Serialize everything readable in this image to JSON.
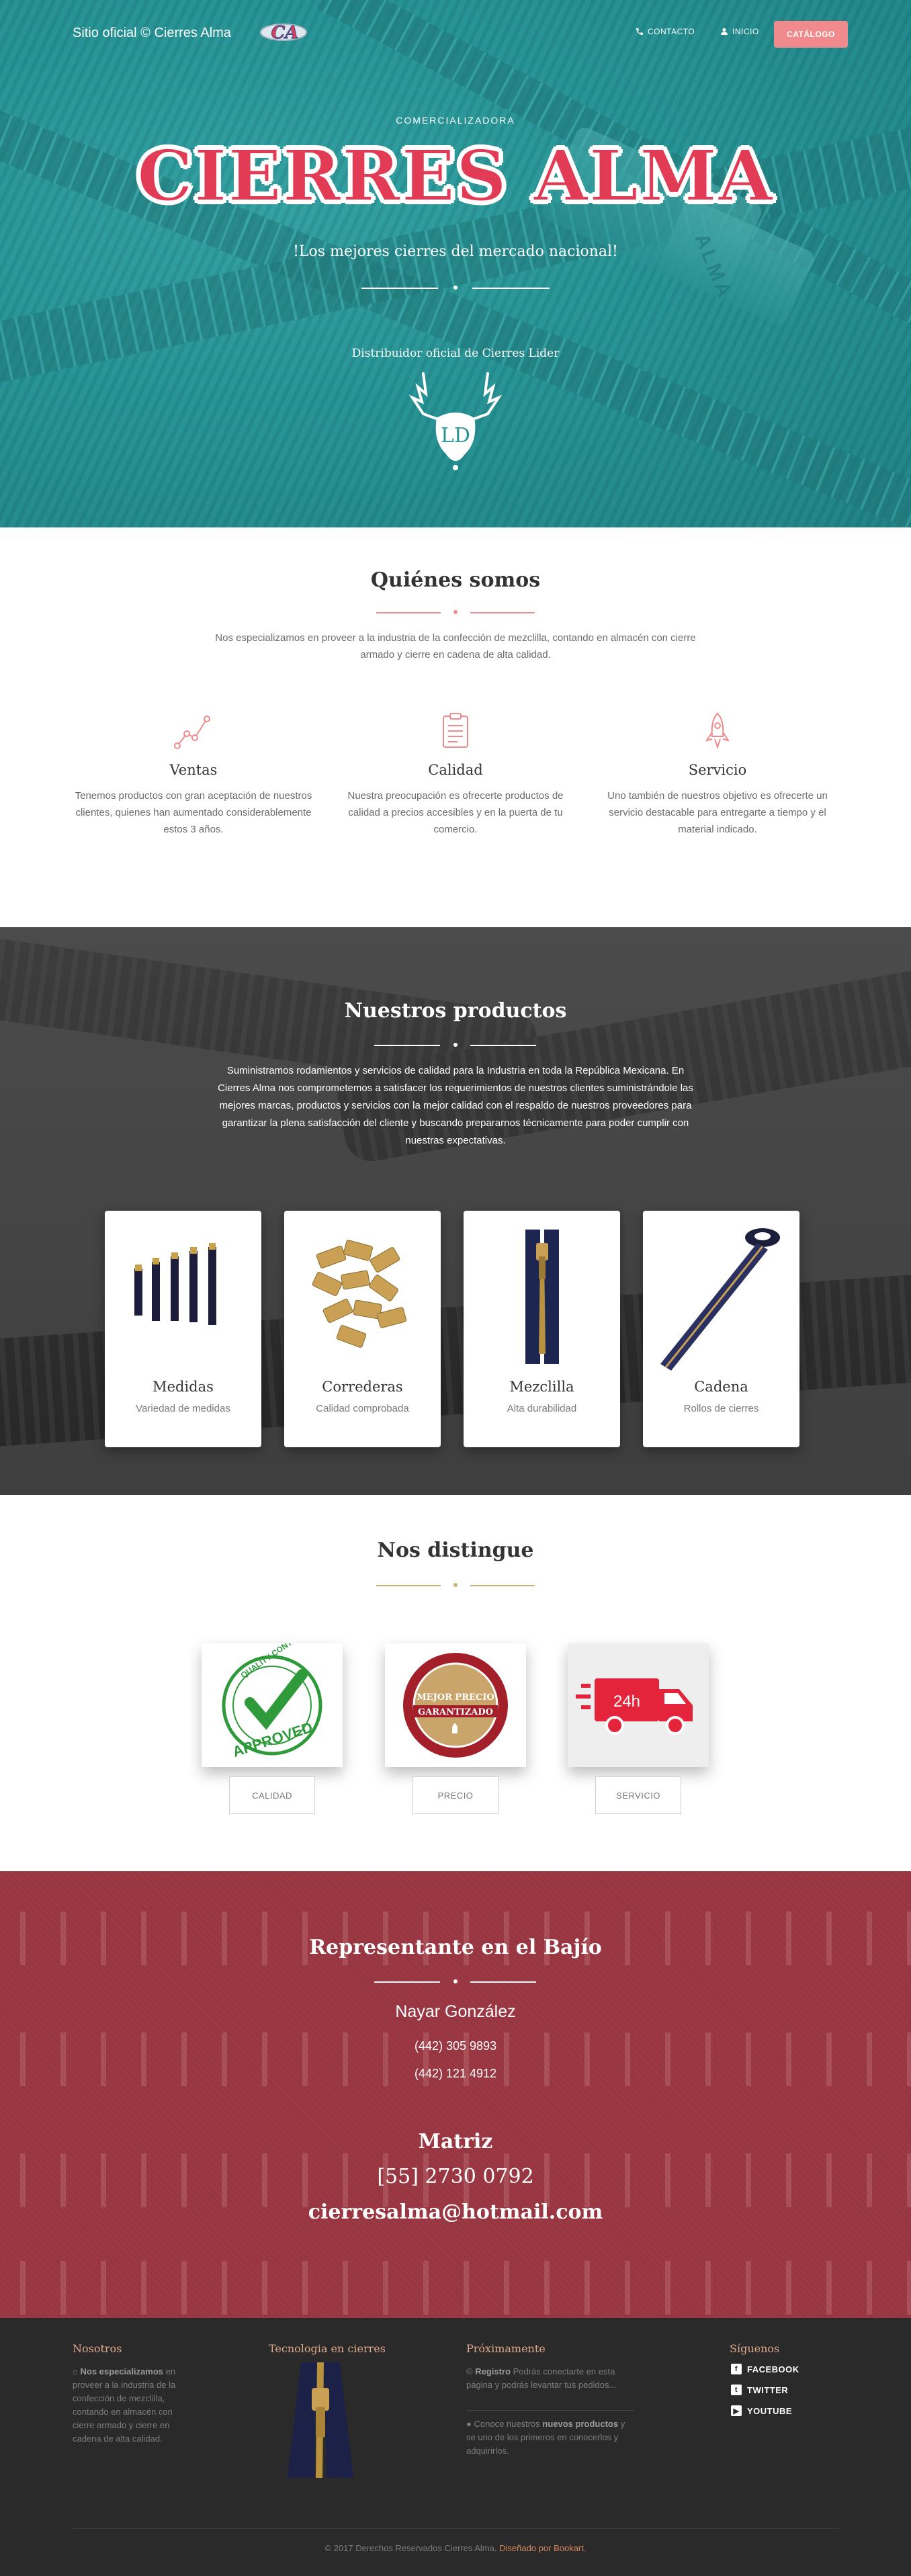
{
  "header": {
    "brand": "Sitio oficial © Cierres Alma",
    "logo_text": "CA",
    "nav": [
      {
        "label": "CONTACTO",
        "icon": "phone-icon"
      },
      {
        "label": "INICIO",
        "icon": "user-icon"
      }
    ],
    "cta": "CATÁLOGO"
  },
  "hero": {
    "eyebrow": "COMERCIALIZADORA",
    "title": "CIERRES ALMA",
    "subtitle": "!Los mejores cierres del mercado nacional!",
    "distributor": "Distribuidor oficial de Cierres Lider",
    "distributor_logo": "LD",
    "background_text": "ALMA"
  },
  "about": {
    "title": "Quiénes somos",
    "intro": "Nos especializamos en proveer a la industria de la confección de mezclilla, contando en almacén con cierre armado y cierre en cadena de alta calidad.",
    "features": [
      {
        "icon": "chart-line-icon",
        "title": "Ventas",
        "text": "Tenemos productos con gran aceptación de nuestros clientes, quienes han aumentado considerablemente estos 3 años."
      },
      {
        "icon": "clipboard-icon",
        "title": "Calidad",
        "text": "Nuestra preocupación es ofrecerte productos de calidad a precios accesibles y en la puerta de tu comercio."
      },
      {
        "icon": "rocket-icon",
        "title": "Servicio",
        "text": "Uno también de nuestros objetivo es ofrecerte un servicio destacable para entregarte a tiempo y el material indicado."
      }
    ]
  },
  "products": {
    "title": "Nuestros productos",
    "intro": "Suministramos rodamientos y servicios de calidad para la Industria en toda la República Mexicana. En Cierres Alma nos comprometemos a satisfacer los requerimientos de nuestros clientes suministrándole las mejores marcas, productos y servicios con la mejor calidad con el respaldo de nuestros proveedores para garantizar la plena satisfacción del cliente y buscando prepararnos técnicamente para poder cumplir con nuestras expectativas.",
    "cards": [
      {
        "title": "Medidas",
        "subtitle": "Variedad de medidas"
      },
      {
        "title": "Correderas",
        "subtitle": "Calidad comprobada"
      },
      {
        "title": "Mezclilla",
        "subtitle": "Alta durabilidad"
      },
      {
        "title": "Cadena",
        "subtitle": "Rollos de cierres"
      }
    ]
  },
  "distinguish": {
    "title": "Nos distingue",
    "badge_texts": {
      "quality_top": "QUALITY CONTROL",
      "quality_main": "APPROVED",
      "price_top": "MEJOR PRECIO",
      "price_main": "GARANTIZADO",
      "truck": "24h"
    },
    "buttons": [
      "CALIDAD",
      "PRECIO",
      "SERVICIO"
    ]
  },
  "representative": {
    "title": "Representante en el Bajío",
    "name": "Nayar González",
    "phone1": "(442) 305 9893",
    "phone2": "(442) 121 4912",
    "matrix_title": "Matriz",
    "matrix_phone": "[55] 2730 0792",
    "email": "cierresalma@hotmail.com"
  },
  "footer": {
    "col1": {
      "title": "Nosotros",
      "lead": "Nos especializamos",
      "text": "en proveer a la industria de la confección de mezclilla, contando en almacén con cierre armado y cierre en cadena de alta calidad."
    },
    "col2": {
      "title": "Tecnologia en cierres"
    },
    "col3": {
      "title": "Próximamente",
      "item1_lead": "Registro",
      "item1_text": "Podrás conectarte en esta página y podrás levantar tus pedidos...",
      "item2_pre": "Conoce nuestros",
      "item2_lead": "nuevos productos",
      "item2_text": "y se uno de los primeros en conocerlos y adquirirlos."
    },
    "col4": {
      "title": "Síguenos",
      "social": [
        {
          "label": "FACEBOOK",
          "icon": "facebook-icon",
          "glyph": "f"
        },
        {
          "label": "TWITTER",
          "icon": "twitter-icon",
          "glyph": "t"
        },
        {
          "label": "YOUTUBE",
          "icon": "youtube-icon",
          "glyph": "▶"
        }
      ]
    },
    "copyright": "© 2017 Derechos Reservados Cierres Alma.",
    "credit": "Diseñado por Bookart."
  },
  "colors": {
    "accent": "#f08a8c",
    "hero_teal": "#238f91",
    "rep_red": "#a84550",
    "footer_bg": "#2a2a2a",
    "footer_heading": "#e0a88a"
  }
}
